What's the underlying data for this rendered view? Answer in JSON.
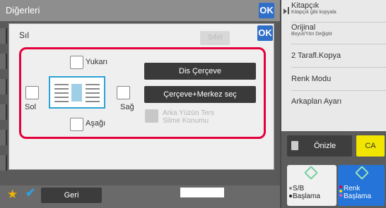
{
  "background": {
    "title": "Diğerleri",
    "ok_label": "OK"
  },
  "dialog": {
    "title": "Sıl",
    "clear_label": "Sıfırl",
    "ok_label": "OK",
    "checkboxes": {
      "top": "Yukarı",
      "left": "Sol",
      "right": "Sağ",
      "bottom": "Aşağı"
    },
    "buttons": {
      "edge": "Dis Çerçeve",
      "edge_center": "Çerçeve+Merkez seç"
    },
    "back_side_line1": "Arka Yüzün Ters",
    "back_side_line2": "Silme Konumu"
  },
  "right_panel": {
    "items": [
      {
        "label": "Kitapçık",
        "sub": "Kitapçık gibi kopyala"
      },
      {
        "label": "Orijinal",
        "sub": "Boyut/Yön Değiştir"
      },
      {
        "label": "2 Tarafl.Kopya",
        "sub": ""
      },
      {
        "label": "Renk Modu",
        "sub": ""
      },
      {
        "label": "Arkaplan Ayarı",
        "sub": ""
      }
    ],
    "preview_label": "Önizle",
    "ca_label": "CA",
    "start_bw": {
      "line1": "S/B",
      "line2": "Başlama"
    },
    "start_color": {
      "line1": "Renk",
      "line2": "Başlama"
    }
  },
  "bottom": {
    "back_label": "Geri"
  },
  "colors": {
    "accent_blue": "#2f6fc8",
    "highlight_red": "#e4003a",
    "ca_yellow": "#f2e600",
    "start_color_blue": "#2474d9"
  }
}
